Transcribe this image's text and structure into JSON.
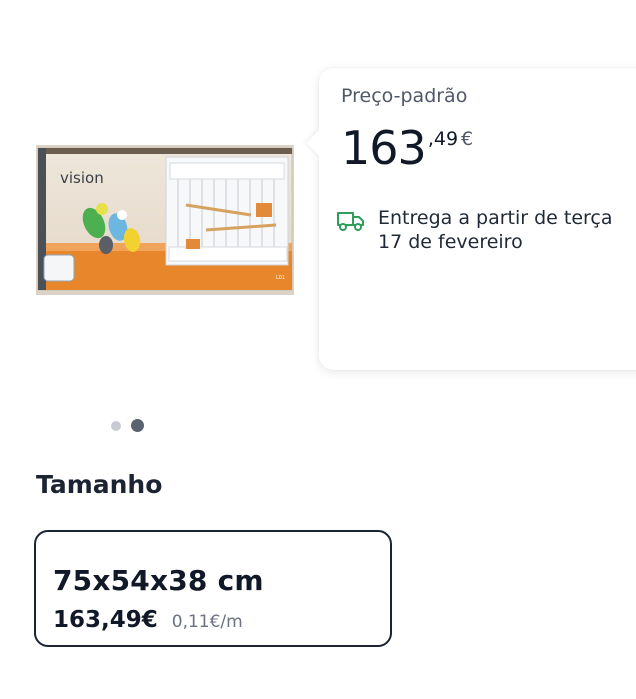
{
  "product": {
    "image_brand_text": "vision",
    "image_model_text": "L01"
  },
  "carousel": {
    "count": 2,
    "active": 2
  },
  "price_card": {
    "label": "Preço-padrão",
    "price_integer": "163",
    "price_decimal": ",49",
    "currency": "€",
    "delivery_line1": "Entrega a partir de terça",
    "delivery_line2": "17 de fevereiro",
    "delivery_icon": "truck-icon",
    "accent_color": "#2f9e5b"
  },
  "size_section": {
    "title": "Tamanho",
    "options": [
      {
        "name": "75x54x38 cm",
        "price": "163,49€",
        "unit_price": "0,11€/m"
      }
    ]
  }
}
